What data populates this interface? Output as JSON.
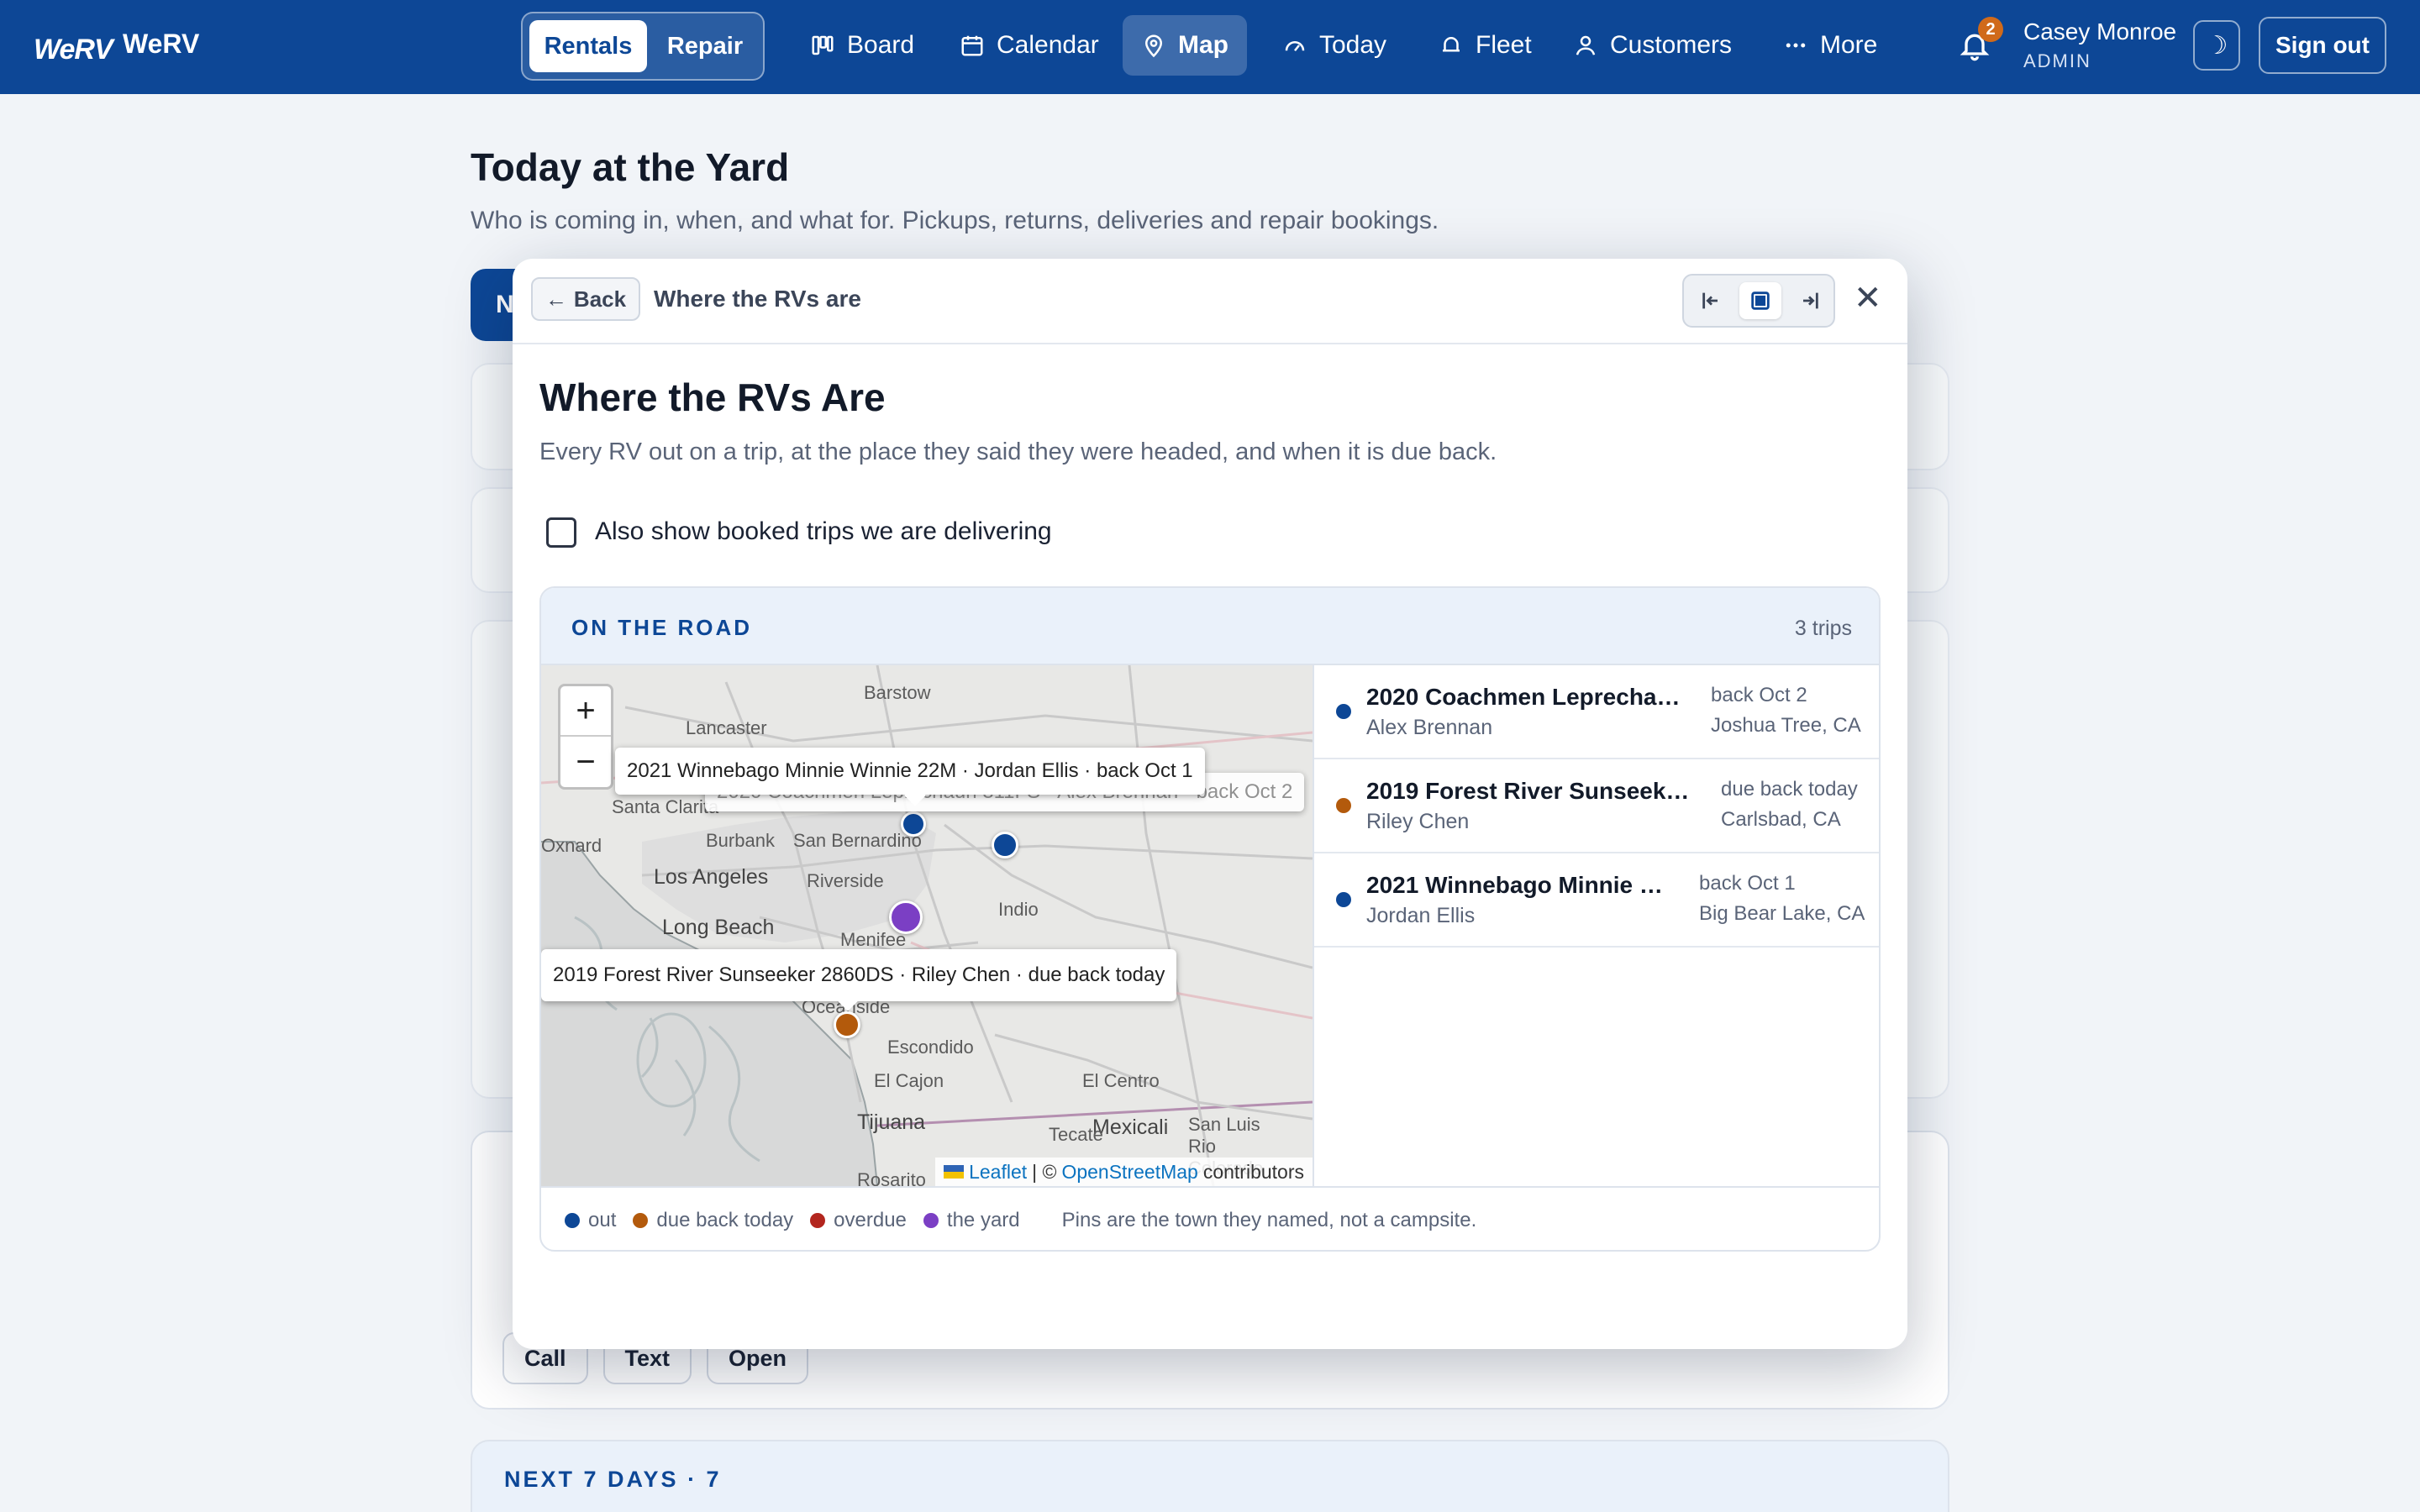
{
  "app": {
    "logo": "WeRV",
    "name": "WeRV"
  },
  "nav": {
    "segment": {
      "active": "Rentals",
      "other": "Repair"
    },
    "items": [
      {
        "label": "Board",
        "icon": "board-icon"
      },
      {
        "label": "Calendar",
        "icon": "calendar-icon"
      },
      {
        "label": "Map",
        "icon": "map-pin-icon"
      },
      {
        "label": "Today",
        "icon": "gauge-icon"
      },
      {
        "label": "Fleet",
        "icon": "rv-icon"
      },
      {
        "label": "Customers",
        "icon": "person-icon"
      },
      {
        "label": "More",
        "icon": "dots-icon"
      }
    ],
    "active": "Map",
    "notifications": "2",
    "user": {
      "name": "Casey Monroe",
      "role": "ADMIN"
    },
    "sign_out": "Sign out"
  },
  "page": {
    "title": "Today at the Yard",
    "subtitle": "Who is coming in, when, and what for. Pickups, returns, deliveries and repair bookings.",
    "bg_actions": [
      "Call",
      "Text",
      "Open"
    ],
    "next7": "NEXT 7 DAYS · 7"
  },
  "modal": {
    "back": "Back",
    "crumb": "Where the RVs are",
    "title": "Where the RVs Are",
    "subtitle": "Every RV out on a trip, at the place they said they were headed, and when it is due back.",
    "checkbox_label": "Also show booked trips we are delivering",
    "section_title": "ON THE ROAD",
    "trip_count": "3 trips",
    "map": {
      "zoom_in": "+",
      "zoom_out": "−",
      "places": [
        "Barstow",
        "Lancaster",
        "Santa Clarita",
        "Oxnard",
        "Burbank",
        "San Bernardino",
        "Los Angeles",
        "Riverside",
        "Long Beach",
        "Menifee",
        "Indio",
        "Oceanside",
        "Escondido",
        "El Cajon",
        "El Centro",
        "Tijuana",
        "Mexicali",
        "San Luis Rio Colorado",
        "Tecate",
        "Rosarito"
      ],
      "tooltips": [
        "2021 Winnebago Minnie Winnie 22M · Jordan Ellis · back Oct 1",
        "2020 Coachmen Leprechaun 311FS · Alex Brennan · back Oct 2",
        "2019 Forest River Sunseeker 2860DS · Riley Chen · due back today"
      ],
      "attribution_leaflet": "Leaflet",
      "attribution_sep": "| ©",
      "attribution_osm": "OpenStreetMap",
      "attribution_tail": "contributors"
    },
    "trips": [
      {
        "name": "2020 Coachmen Leprechaun 311FS",
        "person": "Alex Brennan",
        "when": "back Oct 2",
        "where": "Joshua Tree, CA",
        "status": "out"
      },
      {
        "name": "2019 Forest River Sunseeker 2860DS",
        "person": "Riley Chen",
        "when": "due back today",
        "where": "Carlsbad, CA",
        "status": "due"
      },
      {
        "name": "2021 Winnebago Minnie Winnie 22M",
        "person": "Jordan Ellis",
        "when": "back Oct 1",
        "where": "Big Bear Lake, CA",
        "status": "out"
      }
    ],
    "legend": [
      {
        "label": "out",
        "color": "#0d4796"
      },
      {
        "label": "due back today",
        "color": "#b35a0c"
      },
      {
        "label": "overdue",
        "color": "#b3261e"
      },
      {
        "label": "the yard",
        "color": "#7b3fc4"
      }
    ],
    "legend_note": "Pins are the town they named, not a campsite."
  },
  "colors": {
    "brand": "#0d4796",
    "out": "#0d4796",
    "due": "#b35a0c",
    "overdue": "#b3261e",
    "yard": "#7b3fc4"
  }
}
